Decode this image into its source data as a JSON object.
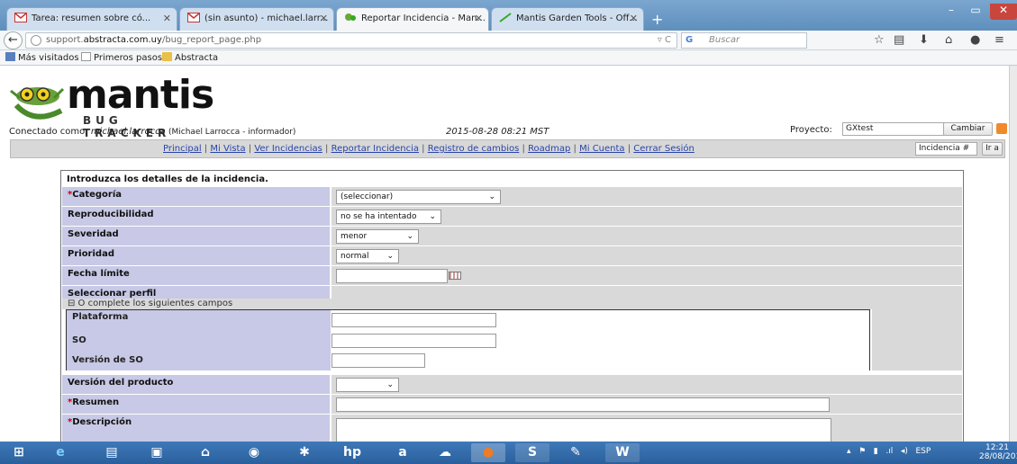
{
  "browser": {
    "tabs": [
      {
        "label": "Tarea: resumen sobre có...",
        "icon": "gmail-icon"
      },
      {
        "label": "(sin asunto) - michael.larr...",
        "icon": "gmail-icon"
      },
      {
        "label": "Reportar Incidencia - Man...",
        "icon": "mantis-icon",
        "active": true
      },
      {
        "label": "Mantis Garden Tools - Off...",
        "icon": "leaf-icon"
      }
    ],
    "new_tab": "+",
    "url_host": "support.",
    "url_domain": "abstracta.com.uy",
    "url_path": "/bug_report_page.php",
    "search_placeholder": "Buscar",
    "bookmarks": [
      "Más visitados",
      "Primeros pasos",
      "Abstracta"
    ]
  },
  "header": {
    "logo_text": "mantis",
    "logo_sub": "BUG TRACKER",
    "connected_label": "Conectado como: ",
    "user": "michael.larrocca",
    "user_detail": "(Michael Larrocca - informador)",
    "datetime": "2015-08-28 08:21 MST",
    "project_label": "Proyecto:",
    "project_value": "GXtest",
    "change_button": "Cambiar",
    "issue_placeholder": "Incidencia #",
    "goto_button": "Ir a"
  },
  "menu": {
    "links": [
      "Principal",
      "Mi Vista",
      "Ver Incidencias",
      "Reportar Incidencia",
      "Registro de cambios",
      "Roadmap",
      "Mi Cuenta",
      "Cerrar Sesión"
    ],
    "separator": " | "
  },
  "form": {
    "title": "Introduzca los detalles de la incidencia.",
    "required_mark": "*",
    "category": {
      "label": "Categoría",
      "value": "(seleccionar)"
    },
    "reproducibility": {
      "label": "Reproducibilidad",
      "value": "no se ha intentado"
    },
    "severity": {
      "label": "Severidad",
      "value": "menor"
    },
    "priority": {
      "label": "Prioridad",
      "value": "normal"
    },
    "due_date": {
      "label": "Fecha límite",
      "value": ""
    },
    "select_profile": {
      "label": "Seleccionar perfil"
    },
    "or_complete": "⊟  O complete los siguientes campos",
    "platform": {
      "label": "Plataforma",
      "value": ""
    },
    "os": {
      "label": "SO",
      "value": ""
    },
    "os_version": {
      "label": "Versión de SO",
      "value": ""
    },
    "product_version": {
      "label": "Versión del producto",
      "value": ""
    },
    "summary": {
      "label": "Resumen",
      "value": ""
    },
    "description": {
      "label": "Descripción",
      "value": ""
    }
  },
  "taskbar": {
    "tray_lang": "ESP",
    "time": "12:21",
    "date": "28/08/2015"
  }
}
